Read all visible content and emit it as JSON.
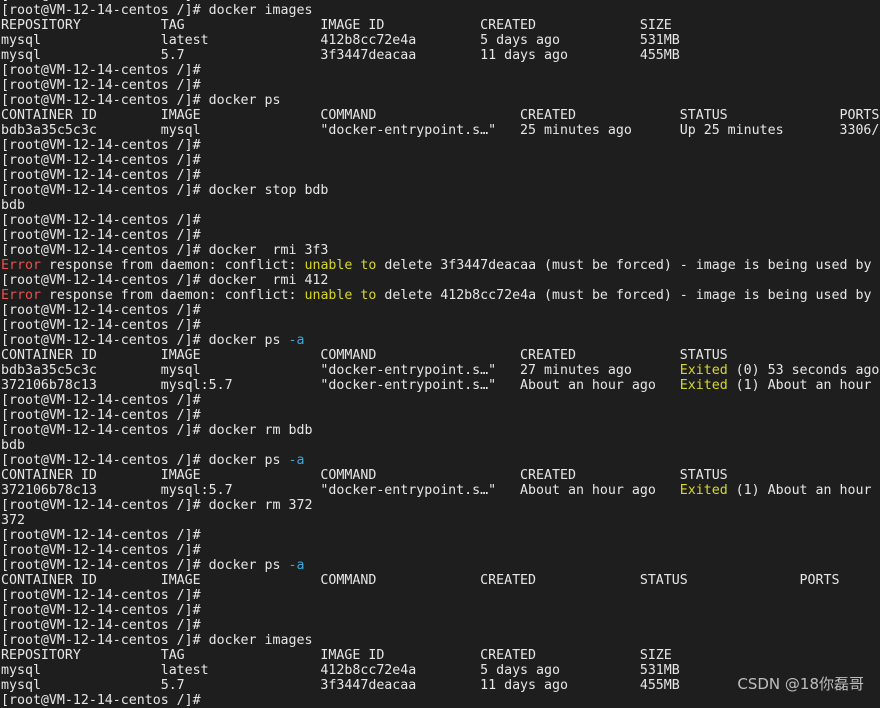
{
  "window": {
    "type": "terminal",
    "prompt": "[root@VM-12-14-centos /]#",
    "colors": {
      "background": "#1e1e1e",
      "text": "#e6e6e6",
      "error": "#e8514f",
      "warning": "#d7d72a",
      "flag": "#3aa8d8"
    }
  },
  "lines": [
    {
      "kind": "prompt",
      "segments": [
        {
          "text": "[root@VM-12-14-centos /]#",
          "style": ""
        }
      ]
    },
    {
      "kind": "prompt",
      "segments": [
        {
          "text": "[root@VM-12-14-centos /]# docker images",
          "style": ""
        }
      ]
    },
    {
      "kind": "output",
      "segments": [
        {
          "text": "REPOSITORY          TAG                 IMAGE ID            CREATED             SIZE",
          "style": ""
        }
      ]
    },
    {
      "kind": "output",
      "segments": [
        {
          "text": "mysql               latest              412b8cc72e4a        5 days ago          531MB",
          "style": ""
        }
      ]
    },
    {
      "kind": "output",
      "segments": [
        {
          "text": "mysql               5.7                 3f3447deacaa        11 days ago         455MB",
          "style": ""
        }
      ]
    },
    {
      "kind": "prompt",
      "segments": [
        {
          "text": "[root@VM-12-14-centos /]#",
          "style": ""
        }
      ]
    },
    {
      "kind": "prompt",
      "segments": [
        {
          "text": "[root@VM-12-14-centos /]#",
          "style": ""
        }
      ]
    },
    {
      "kind": "prompt",
      "segments": [
        {
          "text": "[root@VM-12-14-centos /]# docker ps",
          "style": ""
        }
      ]
    },
    {
      "kind": "output",
      "segments": [
        {
          "text": "CONTAINER ID        IMAGE               COMMAND                  CREATED             STATUS              PORTS",
          "style": ""
        }
      ]
    },
    {
      "kind": "output",
      "segments": [
        {
          "text": "bdb3a35c5c3c        mysql               \"docker-entrypoint.s…\"   25 minutes ago      Up 25 minutes       3306/",
          "style": ""
        }
      ]
    },
    {
      "kind": "prompt",
      "segments": [
        {
          "text": "[root@VM-12-14-centos /]#",
          "style": ""
        }
      ]
    },
    {
      "kind": "prompt",
      "segments": [
        {
          "text": "[root@VM-12-14-centos /]#",
          "style": ""
        }
      ]
    },
    {
      "kind": "prompt",
      "segments": [
        {
          "text": "[root@VM-12-14-centos /]#",
          "style": ""
        }
      ]
    },
    {
      "kind": "prompt",
      "segments": [
        {
          "text": "[root@VM-12-14-centos /]# docker stop bdb",
          "style": ""
        }
      ]
    },
    {
      "kind": "output",
      "segments": [
        {
          "text": "bdb",
          "style": ""
        }
      ]
    },
    {
      "kind": "prompt",
      "segments": [
        {
          "text": "[root@VM-12-14-centos /]#",
          "style": ""
        }
      ]
    },
    {
      "kind": "prompt",
      "segments": [
        {
          "text": "[root@VM-12-14-centos /]#",
          "style": ""
        }
      ]
    },
    {
      "kind": "prompt",
      "segments": [
        {
          "text": "[root@VM-12-14-centos /]# docker  rmi 3f3",
          "style": ""
        }
      ]
    },
    {
      "kind": "error",
      "segments": [
        {
          "text": "Error",
          "style": "error"
        },
        {
          "text": " response from daemon: conflict: ",
          "style": ""
        },
        {
          "text": "unable to",
          "style": "warn"
        },
        {
          "text": " delete 3f3447deacaa (must be forced) - image is being used by",
          "style": ""
        }
      ]
    },
    {
      "kind": "prompt",
      "segments": [
        {
          "text": "[root@VM-12-14-centos /]# docker  rmi 412",
          "style": ""
        }
      ]
    },
    {
      "kind": "error",
      "segments": [
        {
          "text": "Error",
          "style": "error"
        },
        {
          "text": " response from daemon: conflict: ",
          "style": ""
        },
        {
          "text": "unable to",
          "style": "warn"
        },
        {
          "text": " delete 412b8cc72e4a (must be forced) - image is being used by",
          "style": ""
        }
      ]
    },
    {
      "kind": "prompt",
      "segments": [
        {
          "text": "[root@VM-12-14-centos /]#",
          "style": ""
        }
      ]
    },
    {
      "kind": "prompt",
      "segments": [
        {
          "text": "[root@VM-12-14-centos /]#",
          "style": ""
        }
      ]
    },
    {
      "kind": "prompt",
      "segments": [
        {
          "text": "[root@VM-12-14-centos /]# docker ps ",
          "style": ""
        },
        {
          "text": "-a",
          "style": "flag"
        }
      ]
    },
    {
      "kind": "output",
      "segments": [
        {
          "text": "CONTAINER ID        IMAGE               COMMAND                  CREATED             STATUS",
          "style": ""
        }
      ]
    },
    {
      "kind": "output",
      "segments": [
        {
          "text": "bdb3a35c5c3c        mysql               \"docker-entrypoint.s…\"   27 minutes ago      ",
          "style": ""
        },
        {
          "text": "Exited",
          "style": "exited"
        },
        {
          "text": " (0) 53 seconds ago",
          "style": ""
        }
      ]
    },
    {
      "kind": "output",
      "segments": [
        {
          "text": "372106b78c13        mysql:5.7           \"docker-entrypoint.s…\"   About an hour ago   ",
          "style": ""
        },
        {
          "text": "Exited",
          "style": "exited"
        },
        {
          "text": " (1) About an hour",
          "style": ""
        }
      ]
    },
    {
      "kind": "prompt",
      "segments": [
        {
          "text": "[root@VM-12-14-centos /]#",
          "style": ""
        }
      ]
    },
    {
      "kind": "prompt",
      "segments": [
        {
          "text": "[root@VM-12-14-centos /]#",
          "style": ""
        }
      ]
    },
    {
      "kind": "prompt",
      "segments": [
        {
          "text": "[root@VM-12-14-centos /]# docker rm bdb",
          "style": ""
        }
      ]
    },
    {
      "kind": "output",
      "segments": [
        {
          "text": "bdb",
          "style": ""
        }
      ]
    },
    {
      "kind": "prompt",
      "segments": [
        {
          "text": "[root@VM-12-14-centos /]# docker ps ",
          "style": ""
        },
        {
          "text": "-a",
          "style": "flag"
        }
      ]
    },
    {
      "kind": "output",
      "segments": [
        {
          "text": "CONTAINER ID        IMAGE               COMMAND                  CREATED             STATUS",
          "style": ""
        }
      ]
    },
    {
      "kind": "output",
      "segments": [
        {
          "text": "372106b78c13        mysql:5.7           \"docker-entrypoint.s…\"   About an hour ago   ",
          "style": ""
        },
        {
          "text": "Exited",
          "style": "exited"
        },
        {
          "text": " (1) About an hour",
          "style": ""
        }
      ]
    },
    {
      "kind": "prompt",
      "segments": [
        {
          "text": "[root@VM-12-14-centos /]# docker rm 372",
          "style": ""
        }
      ]
    },
    {
      "kind": "output",
      "segments": [
        {
          "text": "372",
          "style": ""
        }
      ]
    },
    {
      "kind": "prompt",
      "segments": [
        {
          "text": "[root@VM-12-14-centos /]#",
          "style": ""
        }
      ]
    },
    {
      "kind": "prompt",
      "segments": [
        {
          "text": "[root@VM-12-14-centos /]#",
          "style": ""
        }
      ]
    },
    {
      "kind": "prompt",
      "segments": [
        {
          "text": "[root@VM-12-14-centos /]# docker ps ",
          "style": ""
        },
        {
          "text": "-a",
          "style": "flag"
        }
      ]
    },
    {
      "kind": "output",
      "segments": [
        {
          "text": "CONTAINER ID        IMAGE               COMMAND             CREATED             STATUS              PORTS",
          "style": ""
        }
      ]
    },
    {
      "kind": "prompt",
      "segments": [
        {
          "text": "[root@VM-12-14-centos /]#",
          "style": ""
        }
      ]
    },
    {
      "kind": "prompt",
      "segments": [
        {
          "text": "[root@VM-12-14-centos /]#",
          "style": ""
        }
      ]
    },
    {
      "kind": "prompt",
      "segments": [
        {
          "text": "[root@VM-12-14-centos /]#",
          "style": ""
        }
      ]
    },
    {
      "kind": "prompt",
      "segments": [
        {
          "text": "[root@VM-12-14-centos /]# docker images",
          "style": ""
        }
      ]
    },
    {
      "kind": "output",
      "segments": [
        {
          "text": "REPOSITORY          TAG                 IMAGE ID            CREATED             SIZE",
          "style": ""
        }
      ]
    },
    {
      "kind": "output",
      "segments": [
        {
          "text": "mysql               latest              412b8cc72e4a        5 days ago          531MB",
          "style": ""
        }
      ]
    },
    {
      "kind": "output",
      "segments": [
        {
          "text": "mysql               5.7                 3f3447deacaa        11 days ago         455MB",
          "style": ""
        }
      ]
    },
    {
      "kind": "prompt",
      "segments": [
        {
          "text": "[root@VM-12-14-centos /]#",
          "style": ""
        }
      ]
    }
  ],
  "watermark": {
    "text": "CSDN @18你磊哥"
  }
}
